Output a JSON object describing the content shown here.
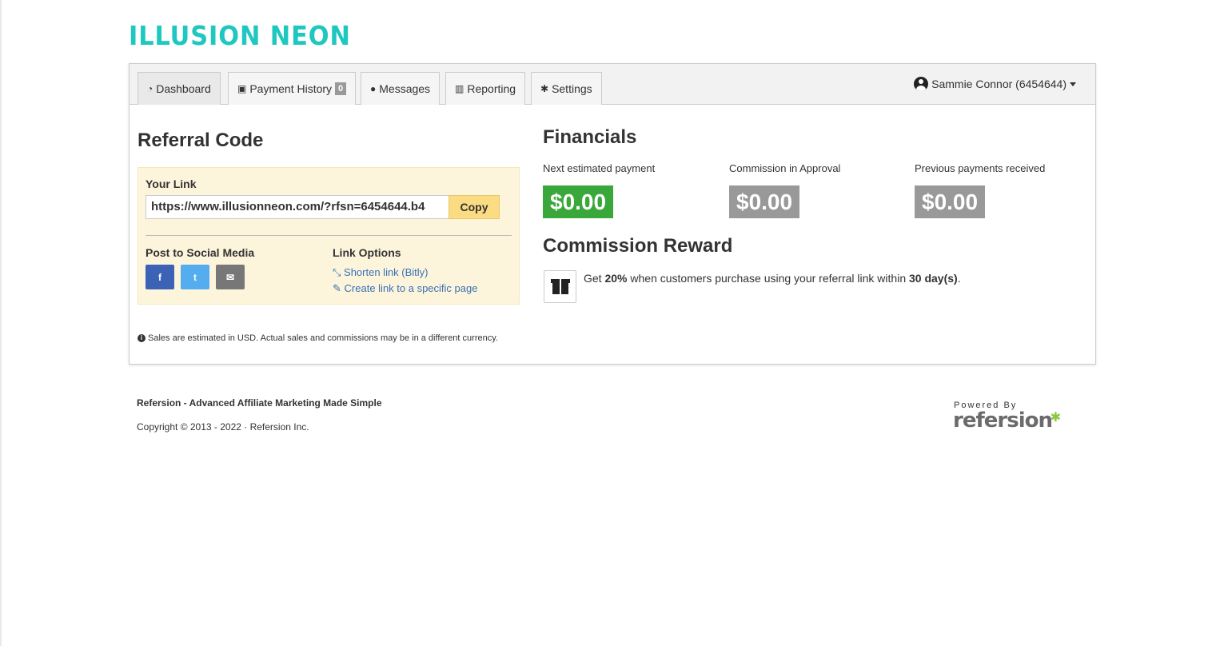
{
  "brand": {
    "logo_text": "ILLUSION NEON",
    "accent": "#1ec7bf"
  },
  "tabs": [
    {
      "label": "Dashboard",
      "icon": "dashboard-icon",
      "active": true
    },
    {
      "label": "Payment History",
      "icon": "money-icon",
      "badge": "0"
    },
    {
      "label": "Messages",
      "icon": "comment-icon"
    },
    {
      "label": "Reporting",
      "icon": "bar-chart-icon"
    },
    {
      "label": "Settings",
      "icon": "gear-icon"
    }
  ],
  "user": {
    "name": "Sammie Connor (6454644)"
  },
  "referral": {
    "title": "Referral Code",
    "your_link_label": "Your Link",
    "link_value": "https://www.illusionneon.com/?rfsn=6454644.b4",
    "copy_label": "Copy",
    "social_label": "Post to Social Media",
    "social": {
      "facebook": "f",
      "twitter": "t",
      "email": "✉"
    },
    "options_label": "Link Options",
    "shorten_link": "Shorten link (Bitly)",
    "create_link": "Create link to a specific page"
  },
  "note": "Sales are estimated in USD. Actual sales and commissions may be in a different currency.",
  "financials": {
    "title": "Financials",
    "items": [
      {
        "label": "Next estimated payment",
        "value": "$0.00",
        "color": "#3aa73a"
      },
      {
        "label": "Commission in Approval",
        "value": "$0.00",
        "color": "#999999"
      },
      {
        "label": "Previous payments received",
        "value": "$0.00",
        "color": "#999999"
      }
    ]
  },
  "commission": {
    "title": "Commission Reward",
    "text_prefix": "Get ",
    "rate": "20%",
    "text_middle": " when customers purchase using your referral link within ",
    "period": "30 day(s)",
    "text_suffix": "."
  },
  "footer": {
    "title": "Refersion - Advanced Affiliate Marketing Made Simple",
    "copyright": "Copyright © 2013 - 2022 · Refersion Inc.",
    "powered_by": "Powered By",
    "powered_logo": "refersion"
  }
}
